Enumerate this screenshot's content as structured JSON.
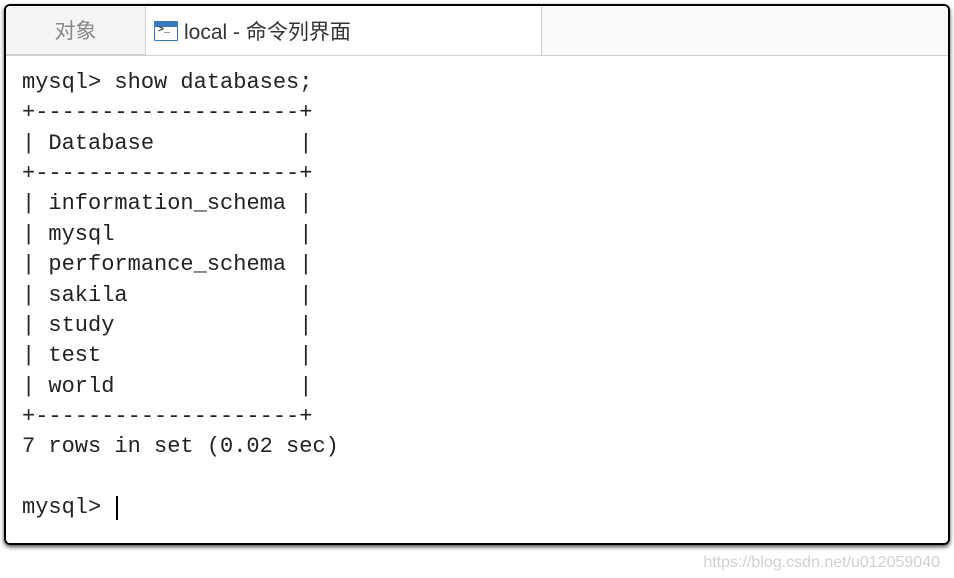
{
  "tabs": {
    "inactive_label": "对象",
    "active_label": "local - 命令列界面"
  },
  "terminal": {
    "prompt": "mysql>",
    "command": "show databases;",
    "border_line": "+--------------------+",
    "header_pipe": "|",
    "header": " Database           ",
    "rows": [
      " information_schema ",
      " mysql              ",
      " performance_schema ",
      " sakila             ",
      " study              ",
      " test               ",
      " world              "
    ],
    "result_summary": "7 rows in set (0.02 sec)",
    "next_prompt": "mysql> "
  },
  "watermark": "https://blog.csdn.net/u012059040"
}
